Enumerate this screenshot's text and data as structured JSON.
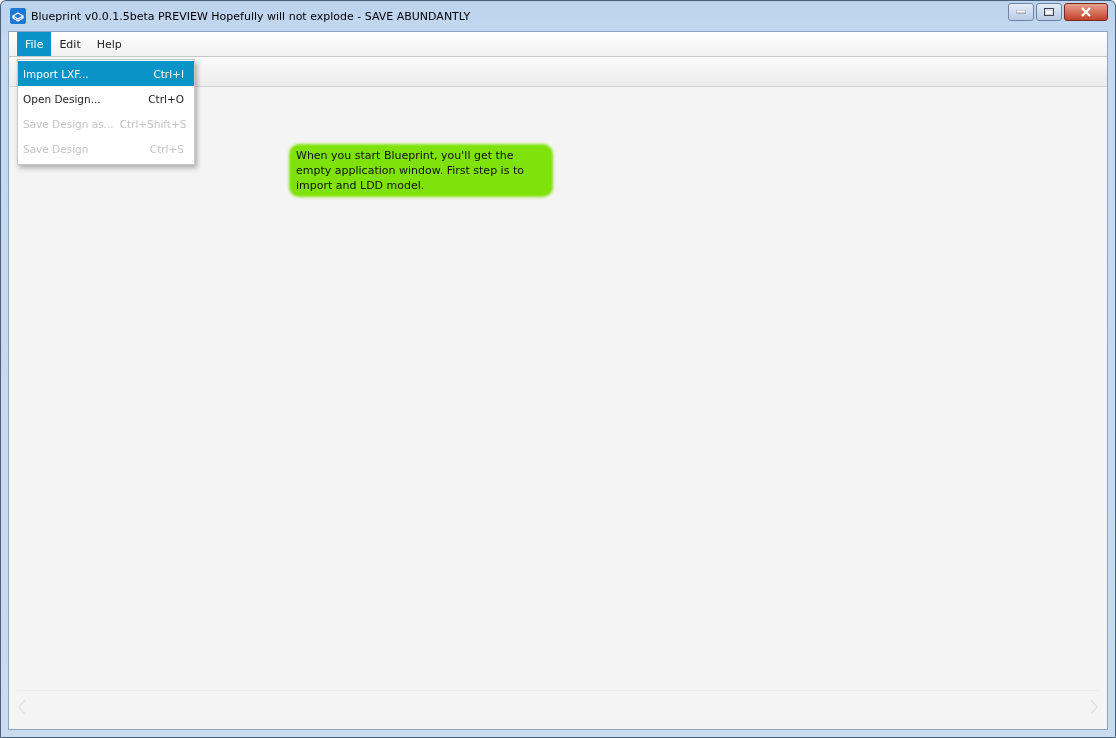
{
  "window": {
    "title": "Blueprint v0.0.1.5beta PREVIEW Hopefully will not explode - SAVE ABUNDANTLY"
  },
  "menu": [
    {
      "label": "File",
      "selected": true
    },
    {
      "label": "Edit",
      "selected": false
    },
    {
      "label": "Help",
      "selected": false
    }
  ],
  "dropdown": [
    {
      "label": "Import LXF...",
      "shortcut": "Ctrl+I",
      "selected": true,
      "disabled": false
    },
    {
      "label": "Open Design...",
      "shortcut": "Ctrl+O",
      "selected": false,
      "disabled": false
    },
    {
      "label": "Save Design as...",
      "shortcut": "Ctrl+Shift+S",
      "selected": false,
      "disabled": true
    },
    {
      "label": "Save Design",
      "shortcut": "Ctrl+S",
      "selected": false,
      "disabled": true
    }
  ],
  "annotation": {
    "text": "When you start Blueprint, you'll get the empty application window. First step is to import and LDD model."
  }
}
